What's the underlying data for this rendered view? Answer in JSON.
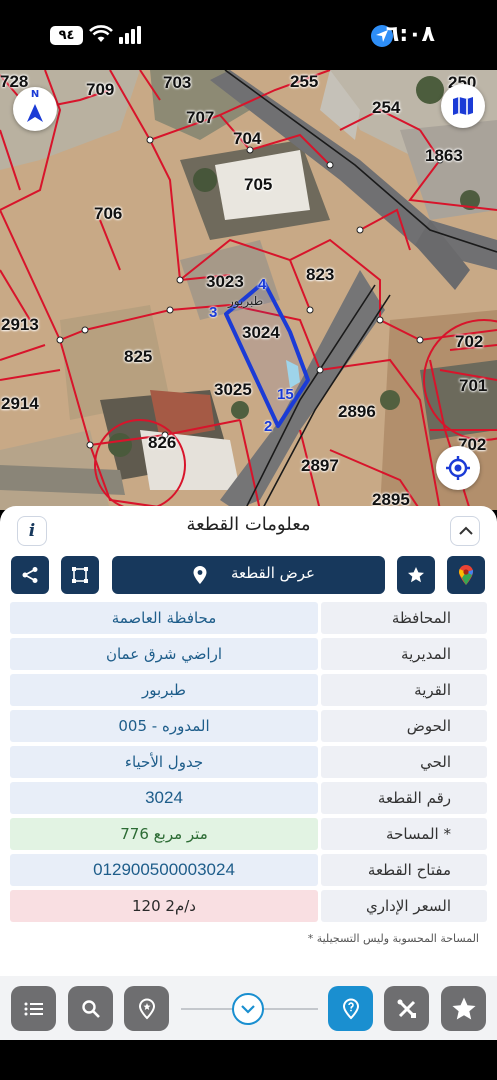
{
  "status_bar": {
    "time": "٦:٠٨",
    "battery": "٩٤",
    "icons": [
      "location-arrow-icon",
      "wifi-icon",
      "signal-bars-icon",
      "battery-icon"
    ]
  },
  "map": {
    "parcels": [
      "728",
      "709",
      "703",
      "255",
      "250",
      "254",
      "707",
      "704",
      "1863",
      "705",
      "706",
      "3023",
      "823",
      "2913",
      "3024",
      "702",
      "825",
      "701",
      "3025",
      "2914",
      "2896",
      "826",
      "702",
      "2897",
      "2895"
    ],
    "vertices": [
      "4",
      "3",
      "15",
      "2"
    ],
    "place_label": "طبربور",
    "icons": [
      "compass-icon",
      "map-layers-icon",
      "my-location-icon"
    ],
    "compass_label": "N"
  },
  "panel": {
    "title": "معلومات القطعة",
    "info_label": "i",
    "view_parcel_label": "عرض القطعة",
    "rows": [
      {
        "label": "المحافظة",
        "value": "محافظة العاصمة"
      },
      {
        "label": "المديرية",
        "value": "اراضي شرق عمان"
      },
      {
        "label": "القرية",
        "value": "طبربور"
      },
      {
        "label": "الحوض",
        "value": "المدوره - 005"
      },
      {
        "label": "الحي",
        "value": "جدول الأحياء"
      },
      {
        "label": "رقم القطعة",
        "value": "3024"
      },
      {
        "label": "المساحة *",
        "value": "776  متر مربع"
      },
      {
        "label": "مفتاح القطعة",
        "value": "012900500003024"
      },
      {
        "label": "السعر الإداري",
        "value": "120 د/م2"
      }
    ],
    "footnote": "* المساحة المحسوبة وليس التسجيلية"
  },
  "toolbar": {
    "buttons": [
      "list-icon",
      "search-icon",
      "location-pin-icon",
      "help-pin-icon",
      "tools-icon",
      "star-icon"
    ]
  },
  "colors": {
    "navy": "#17385c",
    "toolbar_gray": "#6e6e70",
    "accent_blue": "#1a8fd0",
    "parcel_boundary": "#d8142b",
    "selected_parcel": "#1b3bd6",
    "area_green": "#e2f3e3",
    "price_red": "#f9dfe2"
  }
}
